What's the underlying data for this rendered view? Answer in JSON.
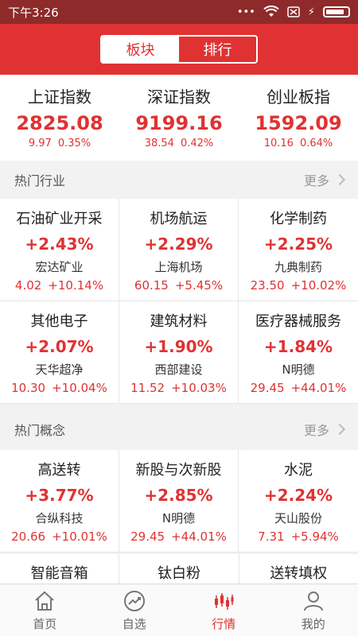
{
  "status_bar": {
    "time": "下午3:26"
  },
  "segment": {
    "options": [
      "板块",
      "排行"
    ],
    "active_index": 0
  },
  "indices": [
    {
      "name": "上证指数",
      "value": "2825.08",
      "change": "9.97",
      "pct": "0.35%"
    },
    {
      "name": "深证指数",
      "value": "9199.16",
      "change": "38.54",
      "pct": "0.42%"
    },
    {
      "name": "创业板指",
      "value": "1592.09",
      "change": "10.16",
      "pct": "0.64%"
    }
  ],
  "hot_industry": {
    "title": "热门行业",
    "more": "更多",
    "items": [
      {
        "name": "石油矿业开采",
        "pct": "+2.43%",
        "stock": "宏达矿业",
        "price": "4.02",
        "stock_pct": "+10.14%"
      },
      {
        "name": "机场航运",
        "pct": "+2.29%",
        "stock": "上海机场",
        "price": "60.15",
        "stock_pct": "+5.45%"
      },
      {
        "name": "化学制药",
        "pct": "+2.25%",
        "stock": "九典制药",
        "price": "23.50",
        "stock_pct": "+10.02%"
      },
      {
        "name": "其他电子",
        "pct": "+2.07%",
        "stock": "天华超净",
        "price": "10.30",
        "stock_pct": "+10.04%"
      },
      {
        "name": "建筑材料",
        "pct": "+1.90%",
        "stock": "西部建设",
        "price": "11.52",
        "stock_pct": "+10.03%"
      },
      {
        "name": "医疗器械服务",
        "pct": "+1.84%",
        "stock": "N明德",
        "price": "29.45",
        "stock_pct": "+44.01%"
      }
    ]
  },
  "hot_concept": {
    "title": "热门概念",
    "more": "更多",
    "items": [
      {
        "name": "高送转",
        "pct": "+3.77%",
        "stock": "合纵科技",
        "price": "20.66",
        "stock_pct": "+10.01%"
      },
      {
        "name": "新股与次新股",
        "pct": "+2.85%",
        "stock": "N明德",
        "price": "29.45",
        "stock_pct": "+44.01%"
      },
      {
        "name": "水泥",
        "pct": "+2.24%",
        "stock": "天山股份",
        "price": "7.31",
        "stock_pct": "+5.94%"
      }
    ],
    "partial_items": [
      "智能音箱",
      "钛白粉",
      "送转填权"
    ]
  },
  "tabs": [
    {
      "label": "首页",
      "icon": "home-icon"
    },
    {
      "label": "自选",
      "icon": "trend-icon"
    },
    {
      "label": "行情",
      "icon": "candlestick-icon"
    },
    {
      "label": "我的",
      "icon": "user-icon"
    }
  ],
  "colors": {
    "brand_red": "#e03232",
    "status_bar": "#8e2a2a"
  }
}
